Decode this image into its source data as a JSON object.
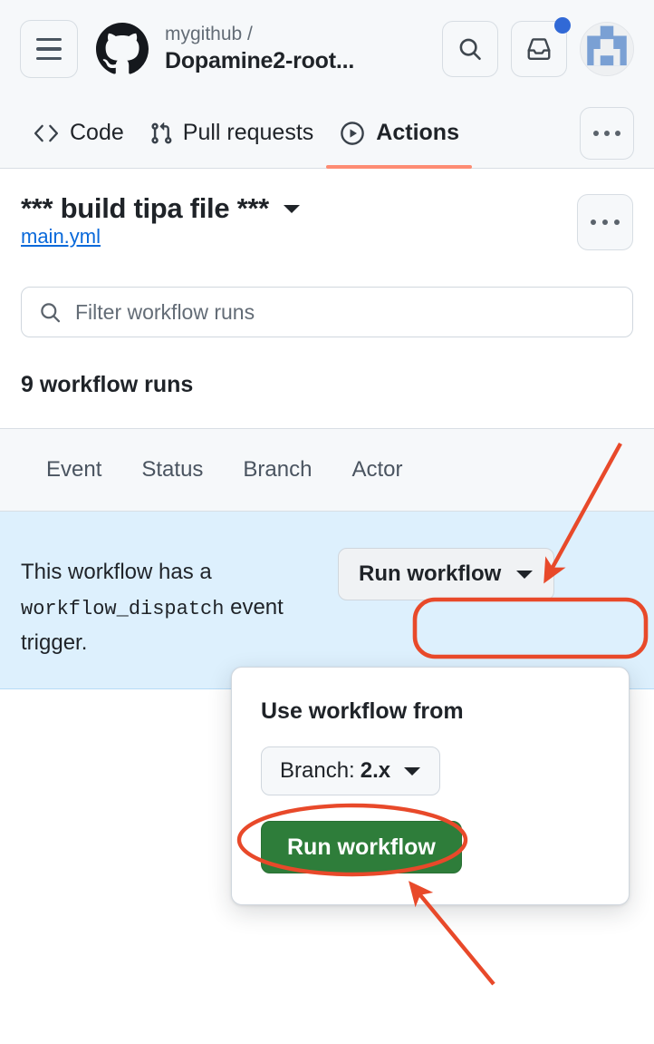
{
  "header": {
    "menu_icon": "hamburger-menu-icon",
    "logo_icon": "github-logo-icon",
    "repo_owner": "mygithub /",
    "repo_name": "Dopamine2-root...",
    "search_icon": "search-icon",
    "inbox_icon": "inbox-icon",
    "has_notification": true,
    "avatar_icon": "user-avatar-identicon"
  },
  "nav": {
    "tabs": [
      {
        "label": "Code",
        "icon": "code-brackets-icon",
        "active": false
      },
      {
        "label": "Pull requests",
        "icon": "git-pull-request-icon",
        "active": false
      },
      {
        "label": "Actions",
        "icon": "play-circle-icon",
        "active": true
      }
    ],
    "overflow_icon": "kebab-horizontal-icon",
    "active_underline_color": "#fd8c73"
  },
  "workflow": {
    "title": "*** build tipa file ***",
    "title_caret_icon": "chevron-down-icon",
    "file_link": "main.yml",
    "kebab_icon": "kebab-horizontal-icon"
  },
  "filter": {
    "icon": "search-icon",
    "placeholder": "Filter workflow runs",
    "value": ""
  },
  "runs": {
    "count_label": "9 workflow runs"
  },
  "filters_row": {
    "items": [
      "Event",
      "Status",
      "Branch",
      "Actor"
    ]
  },
  "dispatch_banner": {
    "text_before": "This workflow has a",
    "text_code": "workflow_dispatch",
    "text_after": "event trigger.",
    "run_button_label": "Run workflow",
    "run_button_caret_icon": "triangle-down-icon",
    "background_color": "#ddf0fd"
  },
  "run_panel": {
    "heading": "Use workflow from",
    "branch_label": "Branch:",
    "branch_value": "2.x",
    "branch_caret_icon": "triangle-down-icon",
    "submit_label": "Run workflow",
    "submit_color": "#2e7d3a"
  },
  "annotations": {
    "color": "#e8492a",
    "shapes": [
      {
        "name": "arrow-to-run-workflow-button",
        "type": "arrow"
      },
      {
        "name": "rounded-rect-around-run-workflow-button",
        "type": "rect"
      },
      {
        "name": "ellipse-around-green-run-workflow-button",
        "type": "ellipse"
      },
      {
        "name": "arrow-to-green-run-workflow-button",
        "type": "arrow"
      }
    ]
  }
}
